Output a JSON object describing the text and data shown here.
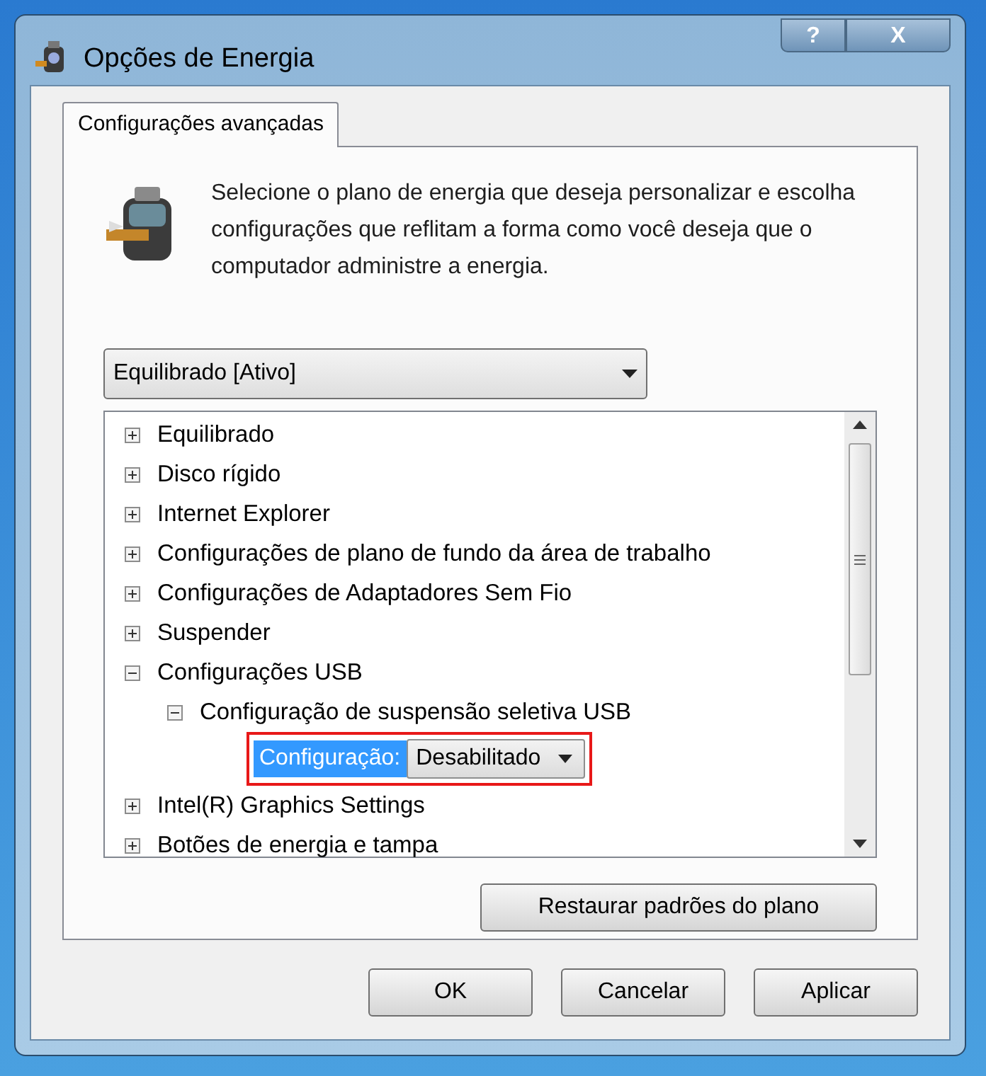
{
  "window": {
    "title": "Opções de Energia",
    "buttons": [
      "?",
      "X"
    ]
  },
  "tabs": [
    {
      "label": "Configurações avançadas",
      "selected": true
    }
  ],
  "description": "Selecione o plano de energia que deseja personalizar e escolha configurações que reflitam a forma como você deseja que o computador administre a energia.",
  "plan_dropdown": {
    "value": "Equilibrado [Ativo]"
  },
  "tree": [
    {
      "kind": "node",
      "label": "Equilibrado",
      "expanded": false
    },
    {
      "kind": "node",
      "label": "Disco rígido",
      "expanded": false
    },
    {
      "kind": "node",
      "label": "Internet Explorer",
      "expanded": false
    },
    {
      "kind": "node",
      "label": "Configurações de plano de fundo da área de trabalho",
      "expanded": false
    },
    {
      "kind": "node",
      "label": "Configurações de Adaptadores Sem Fio",
      "expanded": false
    },
    {
      "kind": "node",
      "label": "Suspender",
      "expanded": false
    },
    {
      "kind": "node",
      "label": "Configurações USB",
      "expanded": true,
      "children": [
        {
          "kind": "node",
          "label": "Configuração de suspensão seletiva USB",
          "expanded": true,
          "children": [
            {
              "kind": "setting",
              "label": "Configuração:",
              "value": "Desabilitado",
              "selected": true,
              "highlighted": true
            }
          ]
        }
      ]
    },
    {
      "kind": "node",
      "label": "Intel(R) Graphics Settings",
      "expanded": false
    },
    {
      "kind": "node",
      "label": "Botões de energia e tampa",
      "expanded": false
    }
  ],
  "restore_button": "Restaurar padrões do plano",
  "buttons": [
    "OK",
    "Cancelar",
    "Aplicar"
  ]
}
